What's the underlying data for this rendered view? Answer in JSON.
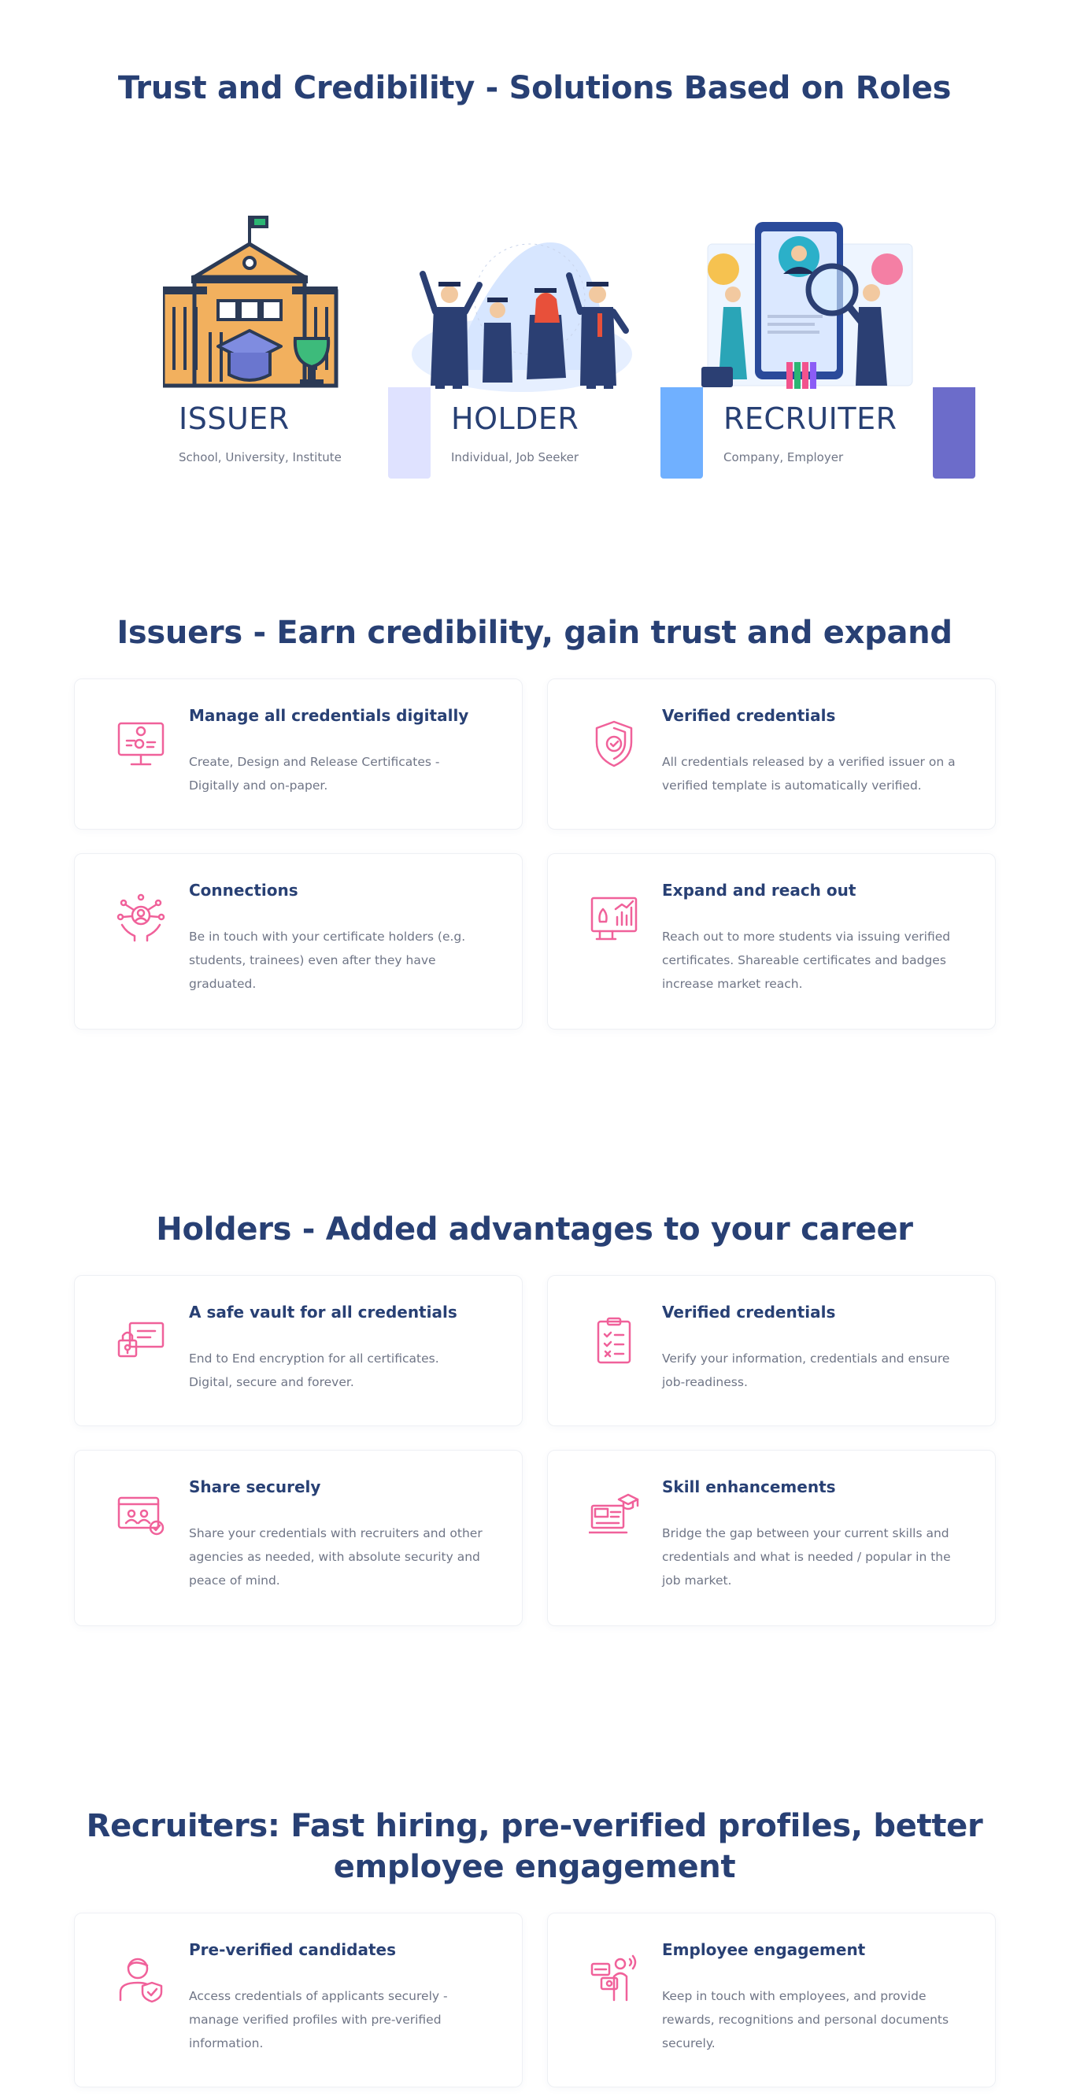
{
  "colors": {
    "heading": "#284074",
    "body_text": "#6f7586",
    "icon_pink": "#f0619a",
    "issuer_bar": "#dfe2ff",
    "holder_bar": "#70b0ff",
    "recruiter_bar": "#6c6cca"
  },
  "roles_section": {
    "title": "Trust and Credibility - Solutions Based on Roles",
    "roles": [
      {
        "title": "ISSUER",
        "subtitle": "School, University, Institute",
        "illustration": "school-building-illustration"
      },
      {
        "title": "HOLDER",
        "subtitle": "Individual, Job Seeker",
        "illustration": "graduates-illustration"
      },
      {
        "title": "RECRUITER",
        "subtitle": "Company, Employer",
        "illustration": "recruiters-illustration"
      }
    ]
  },
  "issuers": {
    "title": "Issuers - Earn credibility, gain trust and expand",
    "cards": [
      {
        "icon": "digital-certificate-icon",
        "title": "Manage all credentials digitally",
        "desc": "Create, Design and Release Certificates - Digitally and on-paper."
      },
      {
        "icon": "verified-shield-icon",
        "title": "Verified credentials",
        "desc": "All credentials released by a verified issuer on a verified template is automatically verified."
      },
      {
        "icon": "connections-icon",
        "title": "Connections",
        "desc": "Be in touch with your certificate holders (e.g. students, trainees) even after they have graduated."
      },
      {
        "icon": "growth-chart-icon",
        "title": "Expand and reach out",
        "desc": "Reach out to more students via issuing verified certificates. Shareable certificates and badges increase market reach."
      }
    ]
  },
  "holders": {
    "title": "Holders - Added advantages to your career",
    "cards": [
      {
        "icon": "secure-vault-icon",
        "title": "A safe vault for all credentials",
        "desc": "End to End encryption for all certificates. Digital, secure and forever."
      },
      {
        "icon": "checklist-clipboard-icon",
        "title": "Verified credentials",
        "desc": "Verify your information, credentials and ensure job-readiness."
      },
      {
        "icon": "share-profiles-icon",
        "title": "Share securely",
        "desc": "Share your credentials with recruiters and other agencies as needed, with absolute security and peace of mind."
      },
      {
        "icon": "skill-laptop-icon",
        "title": "Skill enhancements",
        "desc": "Bridge the gap between your current skills and credentials and what is needed / popular in the job market."
      }
    ]
  },
  "recruiters": {
    "title_line1": "Recruiters: Fast hiring, pre-verified profiles, better",
    "title_line2": "employee engagement",
    "cards": [
      {
        "icon": "verified-candidate-icon",
        "title": "Pre-verified candidates",
        "desc": "Access credentials of applicants securely - manage verified profiles with pre-verified information."
      },
      {
        "icon": "employee-engagement-icon",
        "title": "Employee engagement",
        "desc": "Keep in touch with employees, and provide rewards, recognitions and personal documents securely."
      }
    ]
  }
}
